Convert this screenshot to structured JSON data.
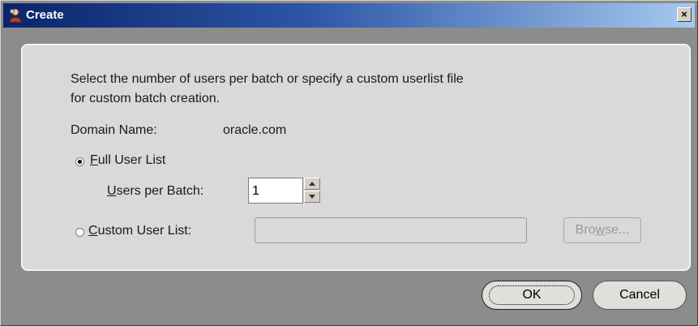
{
  "window": {
    "title": "Create",
    "close_label": "×"
  },
  "content": {
    "description_line1": "Select the number of users per batch or specify a custom userlist file",
    "description_line2": "for custom batch creation.",
    "domain_label": "Domain Name:",
    "domain_value": "oracle.com",
    "full_list": {
      "mnemonic": "F",
      "label_rest": "ull User List",
      "selected": true
    },
    "users_per_batch": {
      "mnemonic": "U",
      "label_rest": "sers per Batch:",
      "value": "1"
    },
    "custom_list": {
      "mnemonic": "C",
      "label_rest": "ustom User List:",
      "selected": false,
      "value": ""
    },
    "browse": {
      "label_pre": "Bro",
      "mnemonic": "w",
      "label_post": "se..."
    }
  },
  "buttons": {
    "ok": "OK",
    "cancel": "Cancel"
  }
}
